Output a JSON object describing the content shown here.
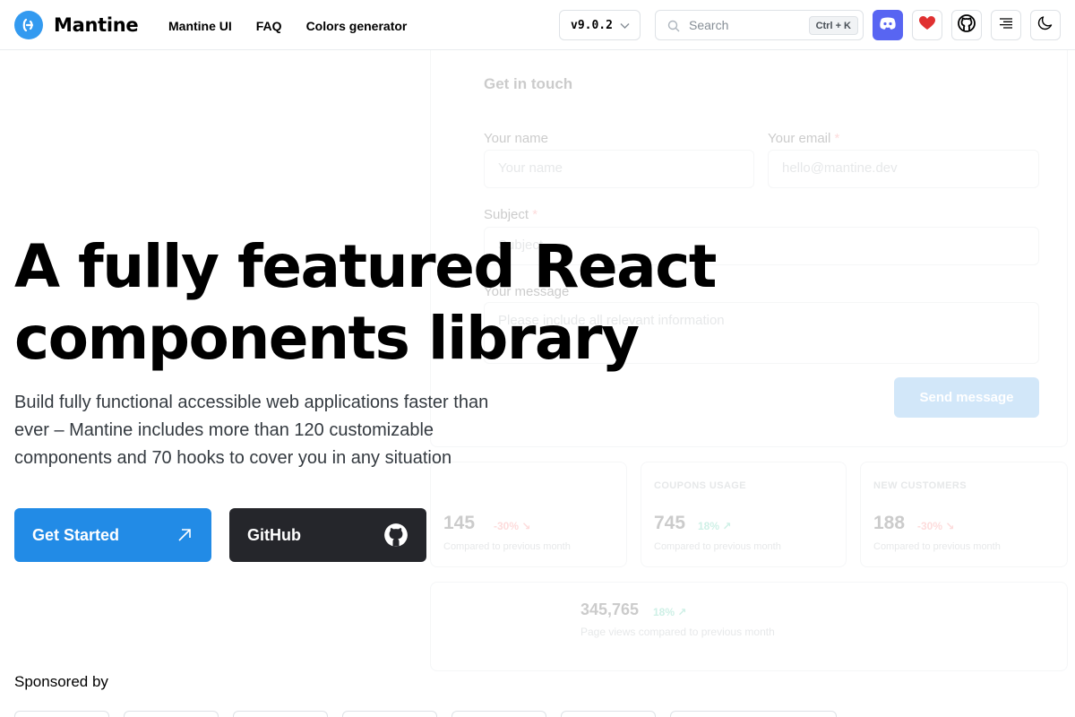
{
  "header": {
    "logo_text": "Mantine",
    "nav": [
      "Mantine UI",
      "FAQ",
      "Colors generator"
    ],
    "version": "v9.0.2",
    "search": {
      "placeholder": "Search",
      "shortcut": "Ctrl + K"
    },
    "icons": [
      "discord-icon",
      "heart-icon",
      "github-icon",
      "menu-icon",
      "moon-icon"
    ],
    "colors": {
      "discord": "#5865f2",
      "heart": "#e03131",
      "accent": "#339af0"
    }
  },
  "hero": {
    "title_line1": "A fully featured React",
    "title_line2": "components library",
    "description": "Build fully functional accessible web applications faster than ever – Mantine includes more than 120 customizable components and 70 hooks to cover you in any situation",
    "primary_button": "Get Started",
    "secondary_button": "GitHub",
    "colors": {
      "primary": "#228be6",
      "dark": "#25262b"
    }
  },
  "sponsored_label": "Sponsored by",
  "demo": {
    "form_title": "Get in touch",
    "name_label": "Your name",
    "name_placeholder": "Your name",
    "email_label": "Your email",
    "email_placeholder": "hello@mantine.dev",
    "subject_label": "Subject",
    "subject_placeholder": "Subject",
    "message_label": "Your message",
    "message_placeholder": "Please include all relevant information",
    "required_mark": "*",
    "send_button": "Send message",
    "stats": [
      {
        "title": "",
        "value": "145",
        "diff": "-30% ↘",
        "caption": "Compared to previous month"
      },
      {
        "title": "COUPONS USAGE",
        "value": "745",
        "diff": "18% ↗",
        "caption": "Compared to previous month"
      },
      {
        "title": "NEW CUSTOMERS",
        "value": "188",
        "diff": "-30% ↘",
        "caption": "Compared to previous month"
      }
    ],
    "wide_stat": {
      "value": "345,765",
      "diff": "18% ↗",
      "caption": "Page views compared to previous month"
    }
  }
}
